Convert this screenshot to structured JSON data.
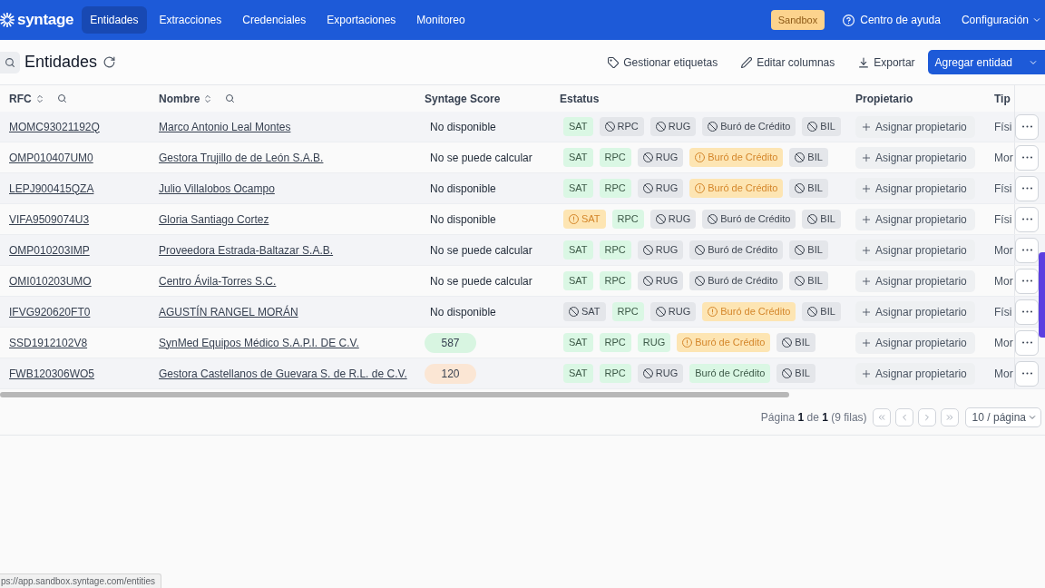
{
  "nav": {
    "logo": "syntage",
    "items": [
      {
        "label": "Entidades",
        "selected": true
      },
      {
        "label": "Extracciones",
        "selected": false
      },
      {
        "label": "Credenciales",
        "selected": false
      },
      {
        "label": "Exportaciones",
        "selected": false
      },
      {
        "label": "Monitoreo",
        "selected": false
      }
    ],
    "environment_badge": "Sandbox",
    "help_link": "Centro de ayuda",
    "settings_menu": "Configuración"
  },
  "toolbar": {
    "title": "Entidades",
    "manage_tags": "Gestionar etiquetas",
    "edit_columns": "Editar columnas",
    "export": "Exportar",
    "primary_button": "Agregar entidad"
  },
  "table": {
    "columns": [
      {
        "label": "RFC",
        "sortable": true,
        "searchable": true
      },
      {
        "label": "Nombre",
        "sortable": true,
        "searchable": true
      },
      {
        "label": "Syntage Score",
        "sortable": false,
        "searchable": false
      },
      {
        "label": "Estatus",
        "sortable": false,
        "searchable": false
      },
      {
        "label": "Propietario",
        "sortable": false,
        "searchable": false
      },
      {
        "label": "Tip",
        "sortable": false,
        "searchable": false
      }
    ],
    "rows": [
      {
        "rfc": "MOMC93021192Q",
        "name": "Marco Antonio Leal Montes",
        "score": {
          "kind": "text",
          "text": "No disponible"
        },
        "statuses": [
          {
            "label": "SAT",
            "kind": "ok"
          },
          {
            "label": "RPC",
            "kind": "blocked"
          },
          {
            "label": "RUG",
            "kind": "blocked"
          },
          {
            "label": "Buró de Crédito",
            "kind": "blocked"
          },
          {
            "label": "BIL",
            "kind": "blocked"
          }
        ],
        "owner": "Asignar propietario",
        "type": "Físi"
      },
      {
        "rfc": "OMP010407UM0",
        "name": "Gestora Trujillo de de León S.A.B.",
        "score": {
          "kind": "text",
          "text": "No se puede calcular"
        },
        "statuses": [
          {
            "label": "SAT",
            "kind": "ok"
          },
          {
            "label": "RPC",
            "kind": "ok"
          },
          {
            "label": "RUG",
            "kind": "blocked"
          },
          {
            "label": "Buró de Crédito",
            "kind": "warning"
          },
          {
            "label": "BIL",
            "kind": "blocked"
          }
        ],
        "owner": "Asignar propietario",
        "type": "Mor"
      },
      {
        "rfc": "LEPJ900415QZA",
        "name": "Julio Villalobos Ocampo",
        "score": {
          "kind": "text",
          "text": "No disponible"
        },
        "statuses": [
          {
            "label": "SAT",
            "kind": "ok"
          },
          {
            "label": "RPC",
            "kind": "ok"
          },
          {
            "label": "RUG",
            "kind": "blocked"
          },
          {
            "label": "Buró de Crédito",
            "kind": "warning"
          },
          {
            "label": "BIL",
            "kind": "blocked"
          }
        ],
        "owner": "Asignar propietario",
        "type": "Físi"
      },
      {
        "rfc": "VIFA9509074U3",
        "name": "Gloria Santiago Cortez",
        "score": {
          "kind": "text",
          "text": "No disponible"
        },
        "statuses": [
          {
            "label": "SAT",
            "kind": "warning"
          },
          {
            "label": "RPC",
            "kind": "ok"
          },
          {
            "label": "RUG",
            "kind": "blocked"
          },
          {
            "label": "Buró de Crédito",
            "kind": "blocked"
          },
          {
            "label": "BIL",
            "kind": "blocked"
          }
        ],
        "owner": "Asignar propietario",
        "type": "Físi"
      },
      {
        "rfc": "OMP010203IMP",
        "name": "Proveedora Estrada-Baltazar S.A.B.",
        "score": {
          "kind": "text",
          "text": "No se puede calcular"
        },
        "statuses": [
          {
            "label": "SAT",
            "kind": "ok"
          },
          {
            "label": "RPC",
            "kind": "ok"
          },
          {
            "label": "RUG",
            "kind": "blocked"
          },
          {
            "label": "Buró de Crédito",
            "kind": "blocked"
          },
          {
            "label": "BIL",
            "kind": "blocked"
          }
        ],
        "owner": "Asignar propietario",
        "type": "Mor"
      },
      {
        "rfc": "OMI010203UMO",
        "name": "Centro Ávila-Torres S.C.",
        "score": {
          "kind": "text",
          "text": "No se puede calcular"
        },
        "statuses": [
          {
            "label": "SAT",
            "kind": "ok"
          },
          {
            "label": "RPC",
            "kind": "ok"
          },
          {
            "label": "RUG",
            "kind": "blocked"
          },
          {
            "label": "Buró de Crédito",
            "kind": "blocked"
          },
          {
            "label": "BIL",
            "kind": "blocked"
          }
        ],
        "owner": "Asignar propietario",
        "type": "Mor"
      },
      {
        "rfc": "IFVG920620FT0",
        "name": "AGUSTÍN RANGEL MORÁN",
        "score": {
          "kind": "text",
          "text": "No disponible"
        },
        "statuses": [
          {
            "label": "SAT",
            "kind": "blocked"
          },
          {
            "label": "RPC",
            "kind": "ok"
          },
          {
            "label": "RUG",
            "kind": "blocked"
          },
          {
            "label": "Buró de Crédito",
            "kind": "warning"
          },
          {
            "label": "BIL",
            "kind": "blocked"
          }
        ],
        "owner": "Asignar propietario",
        "type": "Físi"
      },
      {
        "rfc": "SSD1912102V8",
        "name": "SynMed Equipos Médico S.A.P.I. DE C.V.",
        "score": {
          "kind": "pill",
          "text": "587",
          "color": "#d8f5e1"
        },
        "statuses": [
          {
            "label": "SAT",
            "kind": "ok"
          },
          {
            "label": "RPC",
            "kind": "ok"
          },
          {
            "label": "RUG",
            "kind": "ok"
          },
          {
            "label": "Buró de Crédito",
            "kind": "warning"
          },
          {
            "label": "BIL",
            "kind": "blocked"
          }
        ],
        "owner": "Asignar propietario",
        "type": "Mor"
      },
      {
        "rfc": "FWB120306WO5",
        "name": "Gestora Castellanos de Guevara S. de R.L. de C.V.",
        "score": {
          "kind": "pill",
          "text": "120",
          "color": "#fbe6d4"
        },
        "statuses": [
          {
            "label": "SAT",
            "kind": "ok"
          },
          {
            "label": "RPC",
            "kind": "ok"
          },
          {
            "label": "RUG",
            "kind": "blocked"
          },
          {
            "label": "Buró de Crédito",
            "kind": "ok"
          },
          {
            "label": "BIL",
            "kind": "blocked"
          }
        ],
        "owner": "Asignar propietario",
        "type": "Mor"
      }
    ]
  },
  "pagination": {
    "summary": "Página **1** de **1** (9 filas)",
    "page_size": "10 / página"
  },
  "status_bar": {
    "url": "ps://app.sandbox.syntage.com/entities"
  }
}
